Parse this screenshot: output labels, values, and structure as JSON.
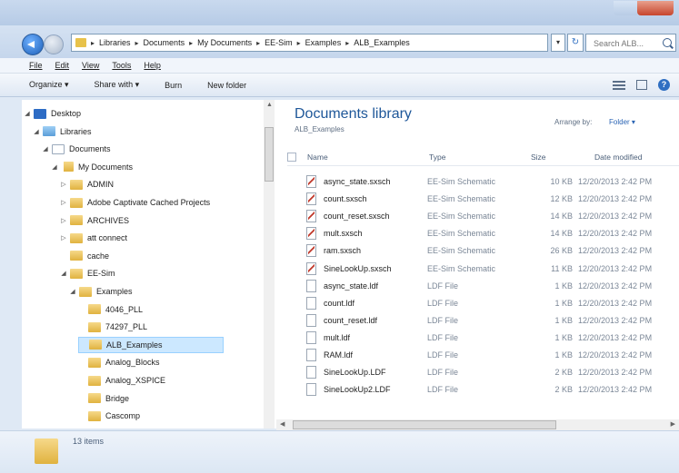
{
  "address_bar": {
    "crumbs": [
      "Libraries",
      "Documents",
      "My Documents",
      "EE-Sim",
      "Examples",
      "ALB_Examples"
    ],
    "search_placeholder": "Search ALB..."
  },
  "menubar": {
    "items": [
      "File",
      "Edit",
      "View",
      "Tools",
      "Help"
    ]
  },
  "toolbar": {
    "organize": "Organize ▾",
    "share": "Share with ▾",
    "burn": "Burn",
    "new_folder": "New folder"
  },
  "nav_tree": [
    {
      "label": "Desktop",
      "indent": 0,
      "icon": "desktop",
      "expander": "◢",
      "selected": false
    },
    {
      "label": "Libraries",
      "indent": 1,
      "icon": "library",
      "expander": "◢",
      "selected": false
    },
    {
      "label": "Documents",
      "indent": 2,
      "icon": "docs",
      "expander": "◢",
      "selected": false
    },
    {
      "label": "My Documents",
      "indent": 3,
      "icon": "mydocs",
      "expander": "◢",
      "selected": false
    },
    {
      "label": "ADMIN",
      "indent": 4,
      "icon": "folder",
      "expander": "▷",
      "selected": false
    },
    {
      "label": "Adobe Captivate Cached Projects",
      "indent": 4,
      "icon": "folder",
      "expander": "▷",
      "selected": false
    },
    {
      "label": "ARCHIVES",
      "indent": 4,
      "icon": "folder",
      "expander": "▷",
      "selected": false
    },
    {
      "label": "att connect",
      "indent": 4,
      "icon": "folder",
      "expander": "▷",
      "selected": false
    },
    {
      "label": "cache",
      "indent": 4,
      "icon": "folder",
      "expander": "",
      "selected": false
    },
    {
      "label": "EE-Sim",
      "indent": 4,
      "icon": "folder",
      "expander": "◢",
      "selected": false
    },
    {
      "label": "Examples",
      "indent": 5,
      "icon": "folder",
      "expander": "◢",
      "selected": false
    },
    {
      "label": "4046_PLL",
      "indent": 6,
      "icon": "folder",
      "expander": "",
      "selected": false
    },
    {
      "label": "74297_PLL",
      "indent": 6,
      "icon": "folder",
      "expander": "",
      "selected": false
    },
    {
      "label": "ALB_Examples",
      "indent": 6,
      "icon": "folder",
      "expander": "",
      "selected": true
    },
    {
      "label": "Analog_Blocks",
      "indent": 6,
      "icon": "folder",
      "expander": "",
      "selected": false
    },
    {
      "label": "Analog_XSPICE",
      "indent": 6,
      "icon": "folder",
      "expander": "",
      "selected": false
    },
    {
      "label": "Bridge",
      "indent": 6,
      "icon": "folder",
      "expander": "",
      "selected": false
    },
    {
      "label": "Cascomp",
      "indent": 6,
      "icon": "folder",
      "expander": "",
      "selected": false
    }
  ],
  "library": {
    "title": "Documents library",
    "subtitle": "ALB_Examples",
    "arrange_label": "Arrange by:",
    "arrange_value": "Folder ▾"
  },
  "columns": {
    "name": "Name",
    "type": "Type",
    "size": "Size",
    "date": "Date modified"
  },
  "files": [
    {
      "name": "async_state.sxsch",
      "type": "EE-Sim Schematic",
      "size": "10 KB",
      "date": "12/20/2013 2:42 PM",
      "icon": "sch"
    },
    {
      "name": "count.sxsch",
      "type": "EE-Sim Schematic",
      "size": "12 KB",
      "date": "12/20/2013 2:42 PM",
      "icon": "sch"
    },
    {
      "name": "count_reset.sxsch",
      "type": "EE-Sim Schematic",
      "size": "14 KB",
      "date": "12/20/2013 2:42 PM",
      "icon": "sch"
    },
    {
      "name": "mult.sxsch",
      "type": "EE-Sim Schematic",
      "size": "14 KB",
      "date": "12/20/2013 2:42 PM",
      "icon": "sch"
    },
    {
      "name": "ram.sxsch",
      "type": "EE-Sim Schematic",
      "size": "26 KB",
      "date": "12/20/2013 2:42 PM",
      "icon": "sch"
    },
    {
      "name": "SineLookUp.sxsch",
      "type": "EE-Sim Schematic",
      "size": "11 KB",
      "date": "12/20/2013 2:42 PM",
      "icon": "sch"
    },
    {
      "name": "async_state.ldf",
      "type": "LDF File",
      "size": "1 KB",
      "date": "12/20/2013 2:42 PM",
      "icon": "ldf"
    },
    {
      "name": "count.ldf",
      "type": "LDF File",
      "size": "1 KB",
      "date": "12/20/2013 2:42 PM",
      "icon": "ldf"
    },
    {
      "name": "count_reset.ldf",
      "type": "LDF File",
      "size": "1 KB",
      "date": "12/20/2013 2:42 PM",
      "icon": "ldf"
    },
    {
      "name": "mult.ldf",
      "type": "LDF File",
      "size": "1 KB",
      "date": "12/20/2013 2:42 PM",
      "icon": "ldf"
    },
    {
      "name": "RAM.ldf",
      "type": "LDF File",
      "size": "1 KB",
      "date": "12/20/2013 2:42 PM",
      "icon": "ldf"
    },
    {
      "name": "SineLookUp.LDF",
      "type": "LDF File",
      "size": "2 KB",
      "date": "12/20/2013 2:42 PM",
      "icon": "ldf"
    },
    {
      "name": "SineLookUp2.LDF",
      "type": "LDF File",
      "size": "2 KB",
      "date": "12/20/2013 2:42 PM",
      "icon": "ldf"
    }
  ],
  "details": {
    "item_count": "13 items"
  }
}
